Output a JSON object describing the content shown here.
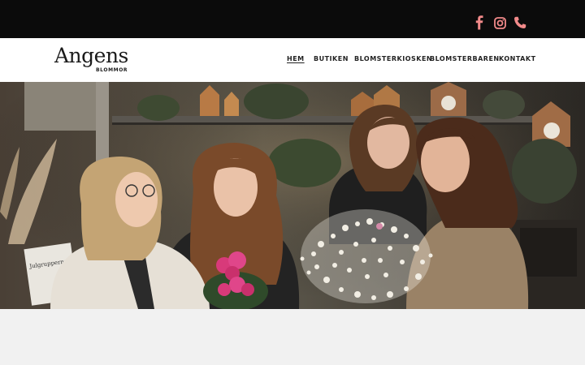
{
  "topbar": {
    "background": "#0b0b0b",
    "accent": "#f28a8a",
    "icons": [
      "facebook-icon",
      "instagram-icon",
      "phone-icon"
    ]
  },
  "brand": {
    "logo_word": "Angens",
    "logo_sub": "BLOMMOR"
  },
  "nav": {
    "items": [
      {
        "label": "HEM",
        "active": true
      },
      {
        "label": "BUTIKEN",
        "active": false
      },
      {
        "label": "BLOMSTERKIOSKEN",
        "active": false
      },
      {
        "label": "BLOMSTERBAREN",
        "active": false
      },
      {
        "label": "KONTAKT",
        "active": false
      }
    ]
  },
  "hero": {
    "sign_text": "Julgrupperna Komma"
  }
}
